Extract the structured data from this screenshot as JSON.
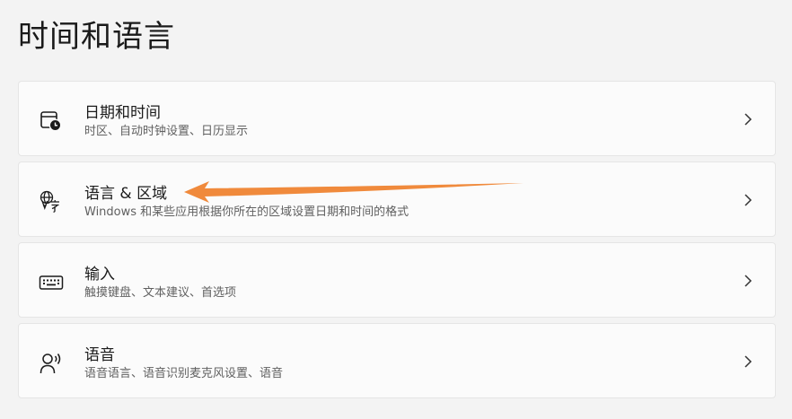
{
  "page": {
    "title": "时间和语言"
  },
  "items": [
    {
      "title": "日期和时间",
      "subtitle": "时区、自动时钟设置、日历显示",
      "icon": "calendar-clock-icon"
    },
    {
      "title": "语言 & 区域",
      "subtitle": "Windows 和某些应用根据你所在的区域设置日期和时间的格式",
      "icon": "language-globe-icon"
    },
    {
      "title": "输入",
      "subtitle": "触摸键盘、文本建议、首选项",
      "icon": "keyboard-icon"
    },
    {
      "title": "语音",
      "subtitle": "语音语言、语音识别麦克风设置、语音",
      "icon": "speech-person-icon"
    }
  ],
  "colors": {
    "background": "#f3f3f3",
    "card": "#fbfbfb",
    "annotation_arrow": "#f08a3c"
  }
}
